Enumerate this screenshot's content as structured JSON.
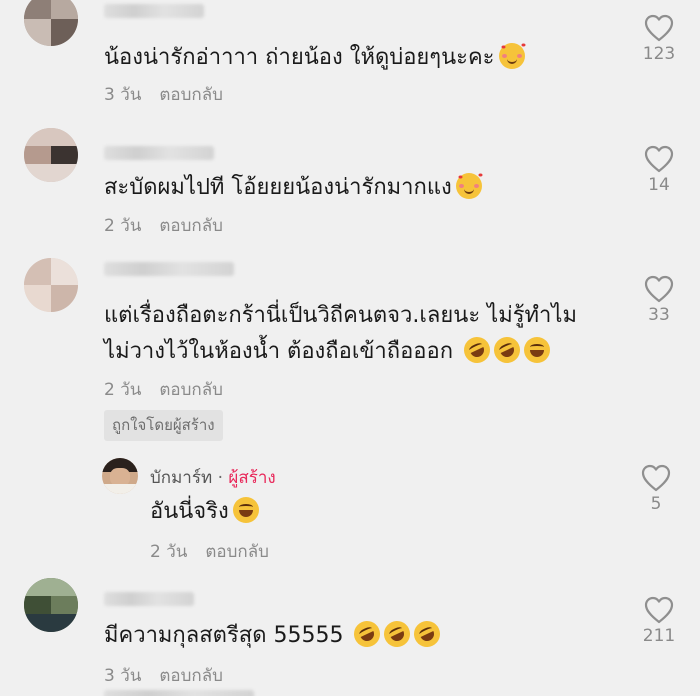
{
  "comments": [
    {
      "text": "น้องน่ารักอ่าาาา ถ่ายน้อง ให้ดูบ่อยๆนะคะ",
      "emojis": [
        "love"
      ],
      "age": "3 วัน",
      "reply_label": "ตอบกลับ",
      "likes": "123"
    },
    {
      "text": "สะบัดผมไปที โอ้ยยยน้องน่ารักมากแง",
      "emojis": [
        "love"
      ],
      "age": "2 วัน",
      "reply_label": "ตอบกลับ",
      "likes": "14"
    },
    {
      "text_line1": "แต่เรื่องถือตะกร้านี่เป็นวิถีคนตจว.เลยนะ ไม่รู้ทำไม",
      "text_line2": "ไม่วางไว้ในห้องน้ำ ต้องถือเข้าถือออก",
      "emojis": [
        "rofl",
        "rofl",
        "laugh"
      ],
      "age": "2 วัน",
      "reply_label": "ตอบกลับ",
      "liked_by_creator": "ถูกใจโดยผู้สร้าง",
      "likes": "33"
    },
    {
      "text": "มีความกุลสตรีสุด 55555",
      "emojis": [
        "rofl",
        "rofl",
        "rofl"
      ],
      "age": "3 วัน",
      "reply_label": "ตอบกลับ",
      "likes": "211"
    }
  ],
  "creator_reply": {
    "author": "บักมาร์ท",
    "separator": " · ",
    "creator_tag": "ผู้สร้าง",
    "text": "อันนี่จริง",
    "emojis": [
      "laugh"
    ],
    "age": "2 วัน",
    "reply_label": "ตอบกลับ",
    "likes": "5"
  },
  "colors": {
    "background": "#f0f0f0",
    "creator_accent": "#e8285a",
    "muted_text": "#8a8a8a"
  },
  "icons": {
    "like": "heart-outline-icon"
  }
}
